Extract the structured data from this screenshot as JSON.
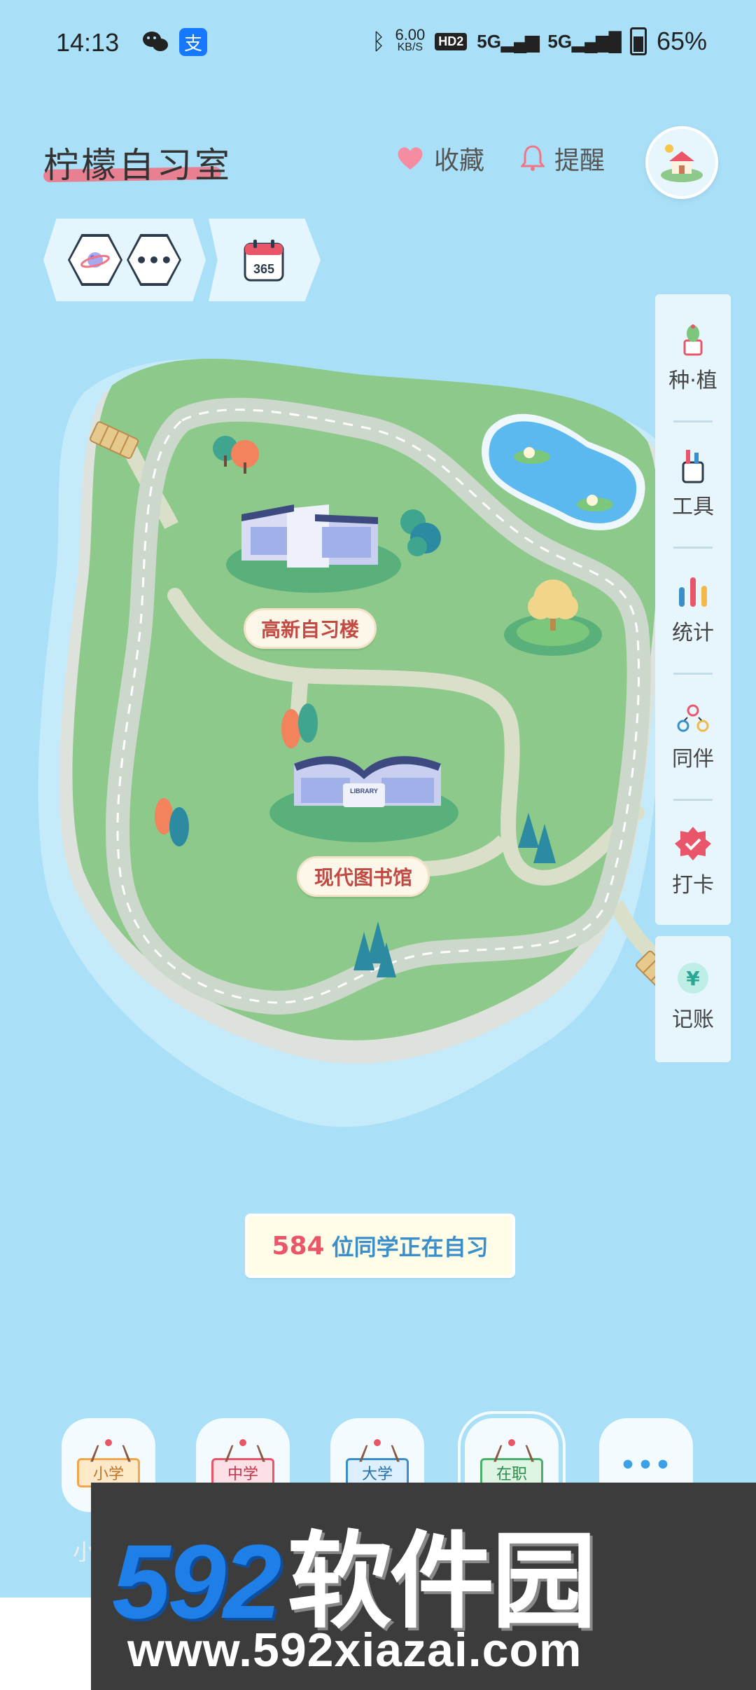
{
  "status_bar": {
    "time": "14:13",
    "wechat_icon": "wechat-icon",
    "alipay_label": "支",
    "speed_value": "6.00",
    "speed_unit": "KB/S",
    "hd_label": "HD2",
    "signal1": "5G",
    "signal2": "5G",
    "battery": "65%"
  },
  "header": {
    "title": "柠檬自习室",
    "favorite_label": "收藏",
    "reminder_label": "提醒"
  },
  "toolbar": {
    "calendar_label": "365"
  },
  "side_menu": {
    "items": [
      {
        "label": "种·植",
        "icon": "cactus-icon"
      },
      {
        "label": "工具",
        "icon": "pencil-cup-icon"
      },
      {
        "label": "统计",
        "icon": "bar-stats-icon"
      },
      {
        "label": "同伴",
        "icon": "companions-icon"
      },
      {
        "label": "打卡",
        "icon": "checkin-badge-icon"
      }
    ],
    "extra": {
      "label": "记账",
      "icon": "yuan-coin-icon"
    }
  },
  "map": {
    "building1_label": "高新自习楼",
    "building2_label": "现代图书馆",
    "library_sign": "LIBRARY"
  },
  "online": {
    "count": "584",
    "text": "位同学正在自习"
  },
  "categories": [
    {
      "sign": "小学",
      "label": "小",
      "selected": false
    },
    {
      "sign": "中学",
      "selected": false
    },
    {
      "sign": "大学",
      "selected": false
    },
    {
      "sign": "在职",
      "selected": true
    },
    {
      "sign": "•••",
      "selected": false
    }
  ],
  "watermark": {
    "big_number": "592",
    "big_cn": "软件园",
    "url": "www.592xiazai.com"
  },
  "colors": {
    "background": "#a9e0f8",
    "accent_pink": "#e9566a",
    "accent_blue": "#3a8fca",
    "island_green": "#8cc98b"
  }
}
